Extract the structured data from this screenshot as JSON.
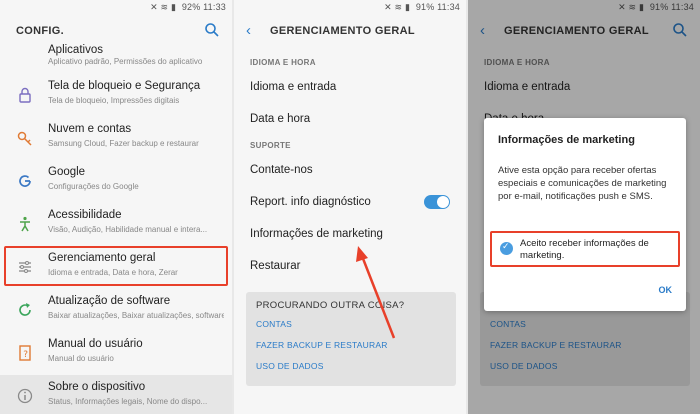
{
  "status_bar": {
    "icons": "✕ ≋ ▮",
    "p1": {
      "battery": "92%",
      "time": "11:33"
    },
    "p2": {
      "battery": "91%",
      "time": "11:34"
    },
    "p3": {
      "battery": "91%",
      "time": "11:34"
    }
  },
  "settings": {
    "title": "CONFIG.",
    "items": [
      {
        "title": "Aplicativos",
        "subtitle": "Aplicativo padrão, Permissões do aplicativo",
        "icon": "apps-icon"
      },
      {
        "title": "Tela de bloqueio e Segurança",
        "subtitle": "Tela de bloqueio, Impressões digitais",
        "icon": "lock-icon"
      },
      {
        "title": "Nuvem e contas",
        "subtitle": "Samsung Cloud, Fazer backup e restaurar",
        "icon": "key-icon"
      },
      {
        "title": "Google",
        "subtitle": "Configurações do Google",
        "icon": "google-icon"
      },
      {
        "title": "Acessibilidade",
        "subtitle": "Visão, Audição, Habilidade manual e intera...",
        "icon": "accessibility-icon"
      },
      {
        "title": "Gerenciamento geral",
        "subtitle": "Idioma e entrada, Data e hora, Zerar",
        "icon": "sliders-icon"
      },
      {
        "title": "Atualização de software",
        "subtitle": "Baixar atualizações, Baixar atualizações, software agen...",
        "icon": "update-icon"
      },
      {
        "title": "Manual do usuário",
        "subtitle": "Manual do usuário",
        "icon": "manual-icon"
      },
      {
        "title": "Sobre o dispositivo",
        "subtitle": "Status, Informações legais, Nome do dispo...",
        "icon": "info-icon"
      }
    ]
  },
  "general": {
    "title": "GERENCIAMENTO GERAL",
    "section_language": "IDIOMA E HORA",
    "language_input": "Idioma e entrada",
    "date_time": "Data e hora",
    "section_support": "SUPORTE",
    "contact_us": "Contate-nos",
    "report_diag": "Report. info diagnóstico",
    "marketing_info": "Informações de marketing",
    "reset": "Restaurar",
    "card": {
      "heading": "PROCURANDO OUTRA COISA?",
      "links": [
        "CONTAS",
        "FAZER BACKUP E RESTAURAR",
        "USO DE DADOS"
      ]
    }
  },
  "dialog": {
    "title": "Informações de marketing",
    "body": "Ative esta opção para receber ofertas especiais e comunicações de marketing por e-mail, notificações push e SMS.",
    "checkbox_label": "Aceito receber informações de marketing.",
    "ok": "OK"
  },
  "colors": {
    "accent": "#2a7bc8",
    "highlight": "#e8402a",
    "toggle_on": "#3a93d8"
  }
}
